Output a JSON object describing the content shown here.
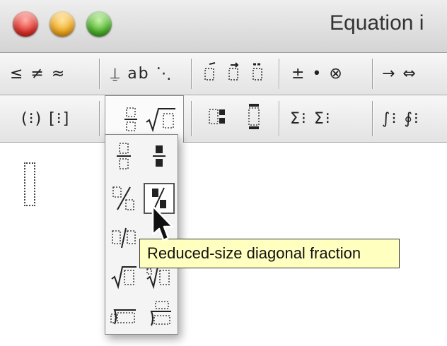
{
  "window": {
    "title": "Equation i",
    "traffic_lights": [
      "close",
      "minimize",
      "zoom"
    ]
  },
  "toolbar_row1": {
    "relations": "≤ ≠ ≈",
    "spaces": "⍊ ab ⋱",
    "embellishments": "⃗ ⃗ ⃗",
    "operators": "± • ⊗",
    "arrows": "→ ⇔"
  },
  "toolbar_row2": {
    "fences": "(⁝) [⁝]",
    "fractions_radicals": "⁝ √⁝",
    "scripts": "⁝⁝ ⁝",
    "sums": "Σ⁝ Σ⁝",
    "integrals": "∫⁝ ∮⁝"
  },
  "palette": {
    "items": [
      {
        "name": "full-size-fraction",
        "glyph": "⁝\n─\n⁝"
      },
      {
        "name": "reduced-size-fraction",
        "glyph": "▪\n─\n▪"
      },
      {
        "name": "full-size-diagonal-fraction",
        "glyph": "⁄"
      },
      {
        "name": "reduced-size-diagonal-fraction",
        "glyph": "⁄"
      },
      {
        "name": "slash-fraction",
        "glyph": "⁝/⁝"
      },
      {
        "name": "reduced-slash-fraction",
        "glyph": "⁝/⁝"
      },
      {
        "name": "square-root",
        "glyph": "√⁝"
      },
      {
        "name": "nth-root",
        "glyph": "√⁝"
      },
      {
        "name": "long-division",
        "glyph": ")⁝"
      },
      {
        "name": "long-division-with-quotient",
        "glyph": ")⁝"
      }
    ]
  },
  "tooltip": {
    "text": "Reduced-size diagonal fraction"
  }
}
